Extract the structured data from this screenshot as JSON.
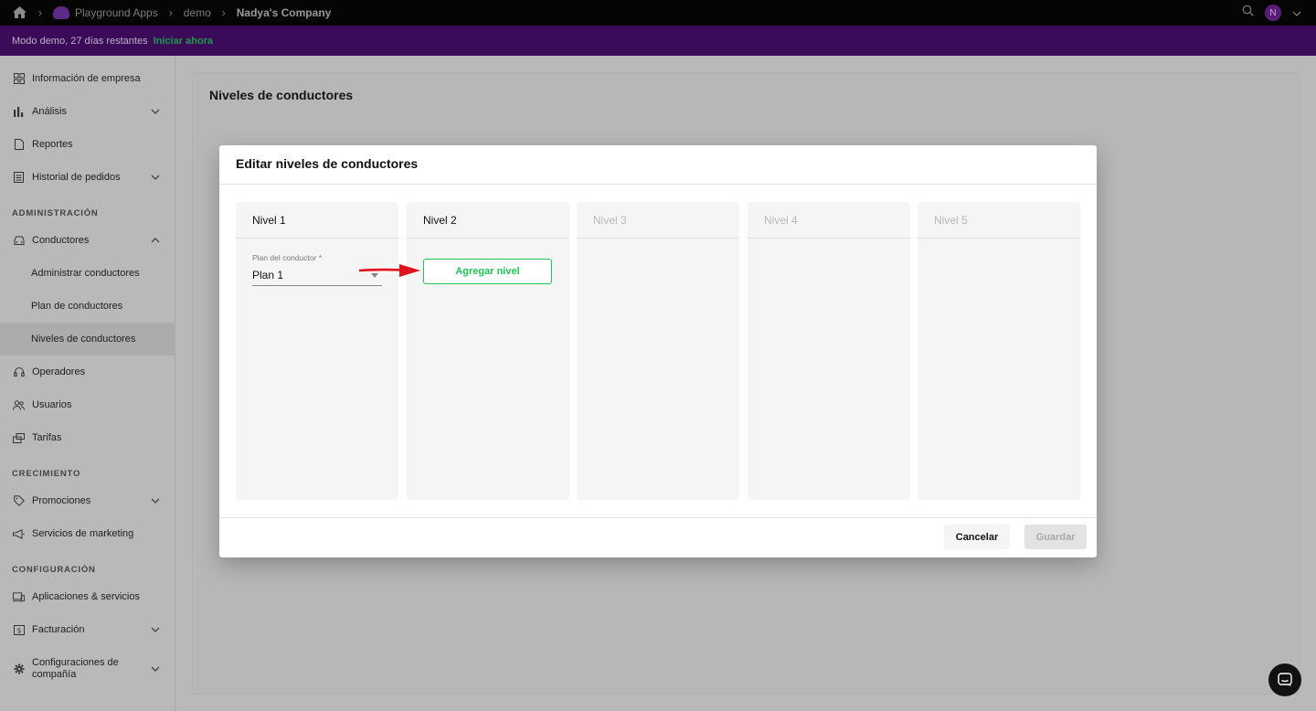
{
  "topbar": {
    "breadcrumb": [
      "Playground Apps",
      "demo",
      "Nadya's Company"
    ],
    "avatar_initial": "N"
  },
  "banner": {
    "text": "Modo demo, 27 días restantes",
    "cta": "Iniciar ahora"
  },
  "sidebar": {
    "items": [
      {
        "label": "Información de empresa",
        "icon": "grid-icon"
      },
      {
        "label": "Análisis",
        "icon": "bar-chart-icon",
        "expandable": true
      },
      {
        "label": "Reportes",
        "icon": "document-icon"
      },
      {
        "label": "Historial de pedidos",
        "icon": "list-icon",
        "expandable": true
      }
    ],
    "section_admin": "ADMINISTRACIÓN",
    "admin_items": [
      {
        "label": "Conductores",
        "icon": "car-icon",
        "expanded": true
      },
      {
        "label": "Administrar conductores"
      },
      {
        "label": "Plan de conductores"
      },
      {
        "label": "Niveles de conductores",
        "active": true
      },
      {
        "label": "Operadores",
        "icon": "headset-icon"
      },
      {
        "label": "Usuarios",
        "icon": "users-icon"
      },
      {
        "label": "Tarifas",
        "icon": "tariff-icon"
      }
    ],
    "section_growth": "CRECIMIENTO",
    "growth_items": [
      {
        "label": "Promociones",
        "icon": "tag-icon",
        "expandable": true
      },
      {
        "label": "Servicios de marketing",
        "icon": "megaphone-icon"
      }
    ],
    "section_config": "CONFIGURACIÓN",
    "config_items": [
      {
        "label": "Aplicaciones & servicios",
        "icon": "devices-icon"
      },
      {
        "label": "Facturación",
        "icon": "billing-icon",
        "expandable": true
      },
      {
        "label": "Configuraciones de compañía",
        "icon": "gear-icon",
        "expandable": true
      }
    ]
  },
  "main": {
    "title": "Niveles de conductores"
  },
  "modal": {
    "title": "Editar niveles de conductores",
    "levels": [
      {
        "label": "Nivel 1",
        "enabled": true
      },
      {
        "label": "Nivel 2",
        "enabled": true
      },
      {
        "label": "Nivel 3",
        "enabled": false
      },
      {
        "label": "Nivel 4",
        "enabled": false
      },
      {
        "label": "Nivel 5",
        "enabled": false
      }
    ],
    "plan_field_label": "Plan del conductor *",
    "plan_field_value": "Plan 1",
    "add_level_label": "Agregar nivel",
    "cancel_label": "Cancelar",
    "save_label": "Guardar"
  },
  "colors": {
    "banner_bg": "#3b0a59",
    "accent_green": "#22c35e",
    "arrow_red": "#e0121c"
  }
}
